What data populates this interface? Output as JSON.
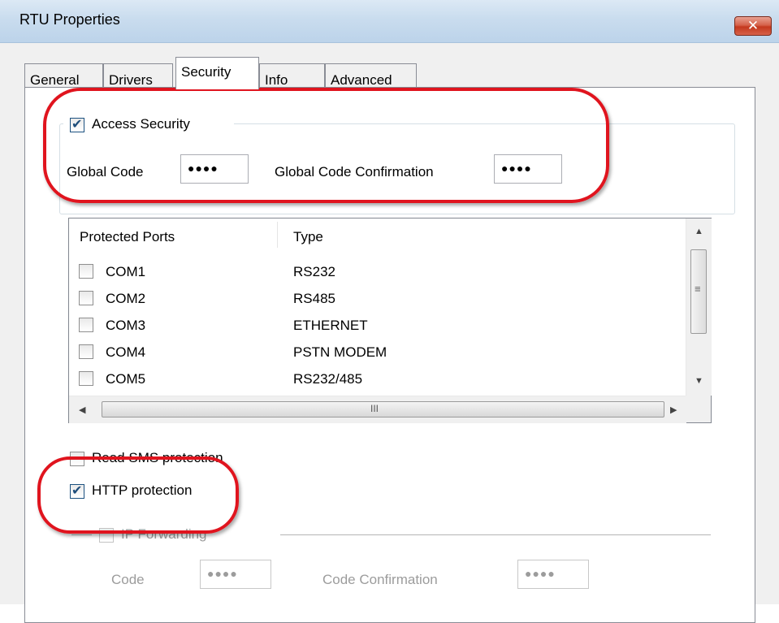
{
  "window": {
    "title": "RTU Properties",
    "close_glyph": "✕"
  },
  "tabs": [
    {
      "label": "General"
    },
    {
      "label": "Drivers"
    },
    {
      "label": "Security"
    },
    {
      "label": "Info"
    },
    {
      "label": "Advanced"
    }
  ],
  "active_tab": "Security",
  "access_security": {
    "label": "Access Security",
    "checked": true,
    "global_code_label": "Global Code",
    "global_code_value": "●●●●",
    "global_code_confirmation_label": "Global Code Confirmation",
    "global_code_confirmation_value": "●●●●"
  },
  "ports_table": {
    "columns": [
      "Protected Ports",
      "Type"
    ],
    "rows": [
      {
        "port": "COM1",
        "type": "RS232",
        "checked": false
      },
      {
        "port": "COM2",
        "type": "RS485",
        "checked": false
      },
      {
        "port": "COM3",
        "type": "ETHERNET",
        "checked": false
      },
      {
        "port": "COM4",
        "type": "PSTN MODEM",
        "checked": false
      },
      {
        "port": "COM5",
        "type": "RS232/485",
        "checked": false
      }
    ],
    "hscroll_grip": "III",
    "vscroll_grip": "≡"
  },
  "options": {
    "read_sms_protection": {
      "label": "Read SMS protection",
      "checked": false
    },
    "http_protection": {
      "label": "HTTP protection",
      "checked": true
    },
    "ip_forwarding": {
      "label": "IP Forwarding",
      "checked": false,
      "enabled": false
    }
  },
  "ip_forwarding": {
    "code_label": "Code",
    "code_value": "●●●●",
    "code_confirmation_label": "Code Confirmation",
    "code_confirmation_value": "●●●●"
  },
  "annotation_color": "#e0141e",
  "icons": {
    "checkmark": "✔",
    "arrow_up": "▲",
    "arrow_down": "▼",
    "arrow_left": "◀",
    "arrow_right": "▶"
  }
}
